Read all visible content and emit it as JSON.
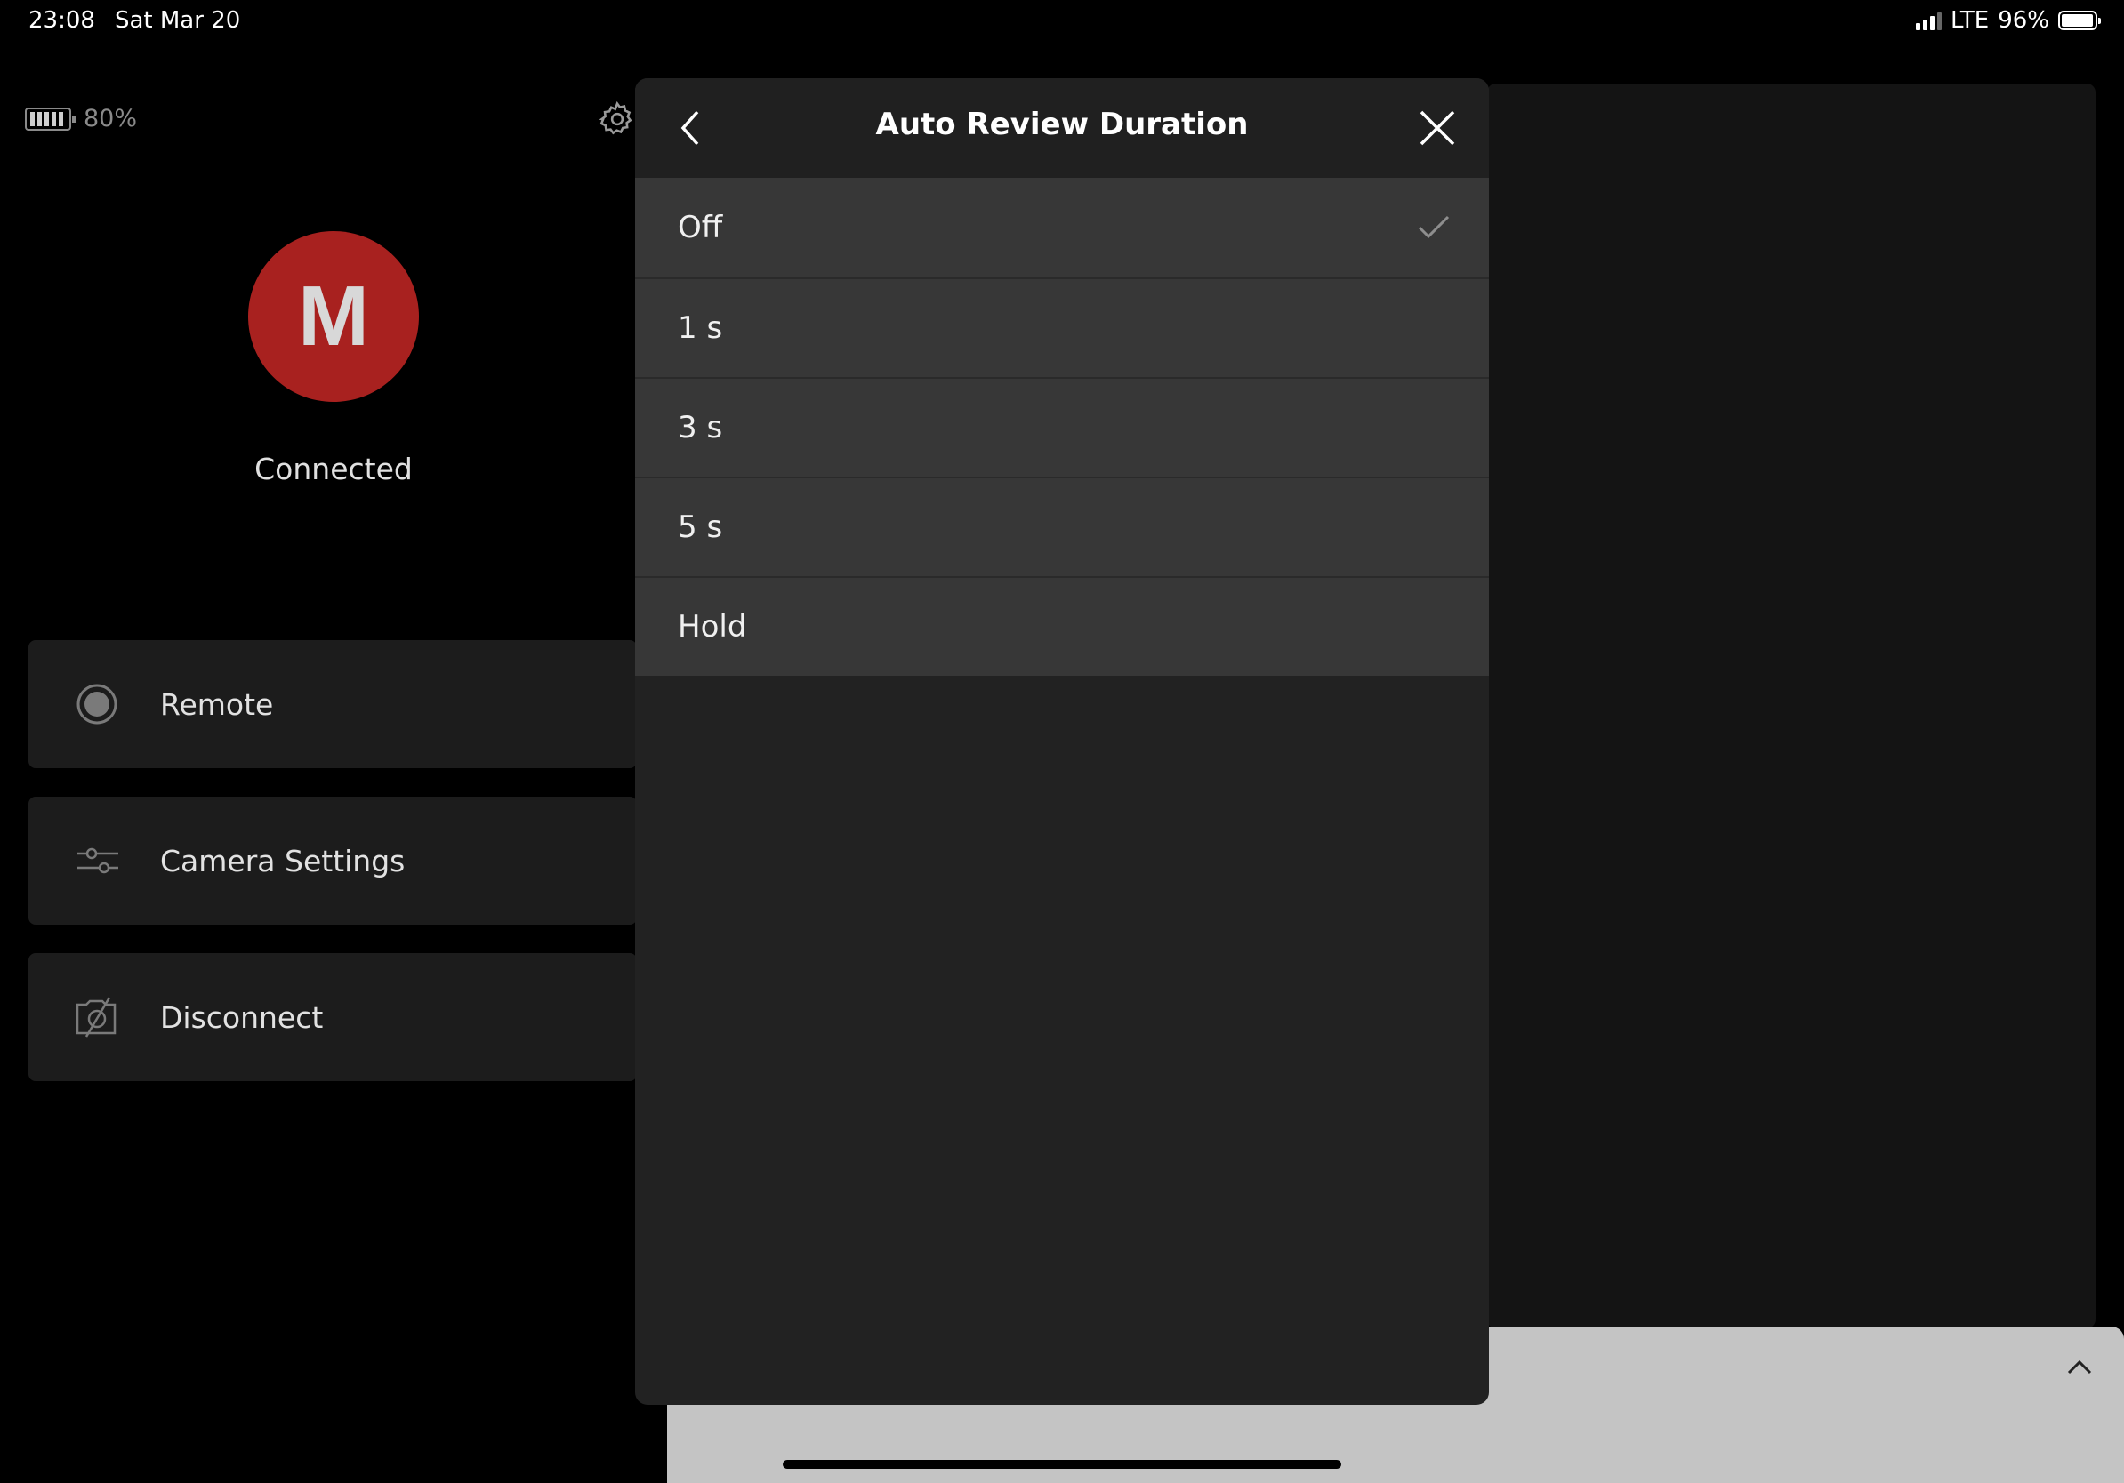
{
  "status_bar": {
    "time": "23:08",
    "date": "Sat Mar 20",
    "network": "LTE",
    "battery": "96%"
  },
  "camera": {
    "battery": "80%",
    "avatar_letter": "M",
    "status": "Connected"
  },
  "menu": {
    "items": [
      {
        "label": "Remote",
        "icon": "record-icon"
      },
      {
        "label": "Camera Settings",
        "icon": "sliders-icon"
      },
      {
        "label": "Disconnect",
        "icon": "disconnect-icon"
      }
    ]
  },
  "modal": {
    "title": "Auto Review Duration",
    "selected": "Off",
    "options": [
      {
        "label": "Off",
        "selected": true
      },
      {
        "label": "1 s",
        "selected": false
      },
      {
        "label": "3 s",
        "selected": false
      },
      {
        "label": "5 s",
        "selected": false
      },
      {
        "label": "Hold",
        "selected": false
      }
    ]
  },
  "colors": {
    "avatar": "#a8211f",
    "modal_bg": "#222222",
    "option_bg": "#373737"
  }
}
